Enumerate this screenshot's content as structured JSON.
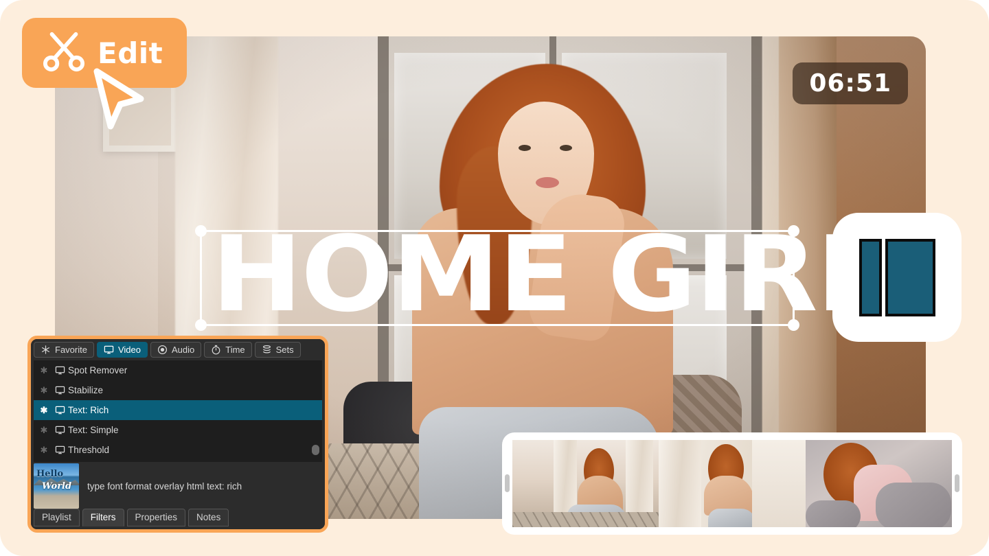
{
  "app": {
    "name": "Shotcut",
    "logo_icon": "shotcut-panes-logo"
  },
  "badge": {
    "label": "Edit",
    "icon": "scissors-icon",
    "cursor_icon": "arrow-pointer-icon",
    "bg_color": "#F9A556"
  },
  "player": {
    "timecode": "06:51"
  },
  "overlay": {
    "text": "HOME GIRL",
    "handles": [
      "top-left",
      "top-right",
      "bottom-left",
      "bottom-right"
    ]
  },
  "filter_panel": {
    "category_tabs": [
      {
        "label": "Favorite",
        "icon": "asterisk-icon",
        "active": false
      },
      {
        "label": "Video",
        "icon": "monitor-icon",
        "active": true
      },
      {
        "label": "Audio",
        "icon": "speaker-circle-icon",
        "active": false
      },
      {
        "label": "Time",
        "icon": "stopwatch-icon",
        "active": false
      },
      {
        "label": "Sets",
        "icon": "layers-icon",
        "active": false
      }
    ],
    "filters": [
      {
        "label": "Spot Remover",
        "icon": "monitor-icon",
        "favorite": false,
        "selected": false
      },
      {
        "label": "Stabilize",
        "icon": "monitor-icon",
        "favorite": false,
        "selected": false
      },
      {
        "label": "Text: Rich",
        "icon": "monitor-icon",
        "favorite": true,
        "selected": true
      },
      {
        "label": "Text: Simple",
        "icon": "monitor-icon",
        "favorite": false,
        "selected": false
      },
      {
        "label": "Threshold",
        "icon": "monitor-icon",
        "favorite": false,
        "selected": false
      }
    ],
    "detail": {
      "description": "type font format overlay html text: rich",
      "thumbnail_text_line1": "Hello",
      "thumbnail_text_line2": "World"
    },
    "bottom_tabs": [
      {
        "label": "Playlist",
        "active": false
      },
      {
        "label": "Filters",
        "active": true
      },
      {
        "label": "Properties",
        "active": false
      },
      {
        "label": "Notes",
        "active": false
      }
    ],
    "selection_color": "#0a5f7a",
    "border_color": "#F9A556"
  },
  "thumbnail_strip": {
    "count": 3,
    "items": [
      {
        "alt": "woman sitting on window sill"
      },
      {
        "alt": "woman holding curtain by window"
      },
      {
        "alt": "woman lying in bed"
      }
    ]
  },
  "theme": {
    "page_bg": "#FDEEDD",
    "accent": "#F9A556",
    "teal": "#0a5f7a",
    "panel_bg": "#2c2c2c"
  }
}
